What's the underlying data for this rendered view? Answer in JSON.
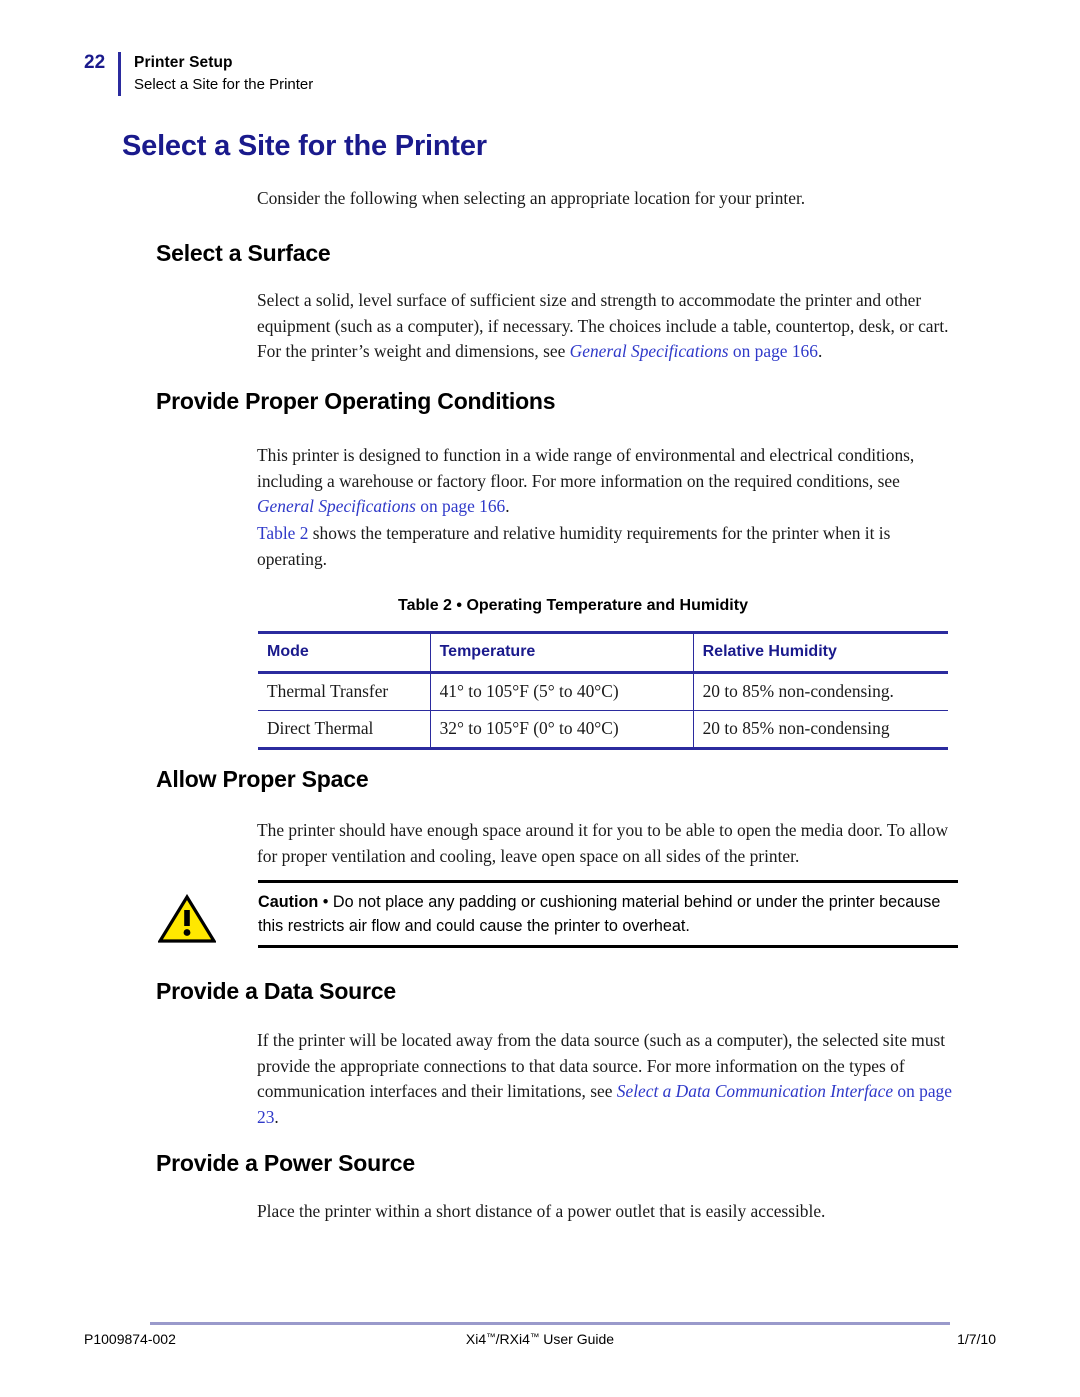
{
  "header": {
    "page_number": "22",
    "chapter": "Printer Setup",
    "section": "Select a Site for the Printer",
    "accent_color": "#2b2b9e"
  },
  "title": "Select a Site for the Printer",
  "title_color": "#1a1a8c",
  "intro_paragraph": "Consider the following when selecting an appropriate location for your printer.",
  "sections": [
    {
      "heading": "Select a Surface",
      "paragraph_lead": "Select a solid, level surface of sufficient size and strength to accommodate the printer and other equipment (such as a computer), if necessary. The choices include a table, countertop, desk, or cart. For the printer’s weight and dimensions, see ",
      "link_title": "General Specifications",
      "link_page": " on page 166",
      "paragraph_tail": "."
    },
    {
      "heading": "Provide Proper Operating Conditions",
      "paragraph_lead": "This printer is designed to function in a wide range of environmental and electrical conditions, including a warehouse or factory floor. For more information on the required conditions, see ",
      "link_title": "General Specifications",
      "link_page": " on page 166",
      "paragraph_tail": ".",
      "second_paragraph_link": "Table 2",
      "second_paragraph_rest": " shows the temperature and relative humidity requirements for the printer when it is operating."
    },
    {
      "heading": "Allow Proper Space",
      "paragraph": "The printer should have enough space around it for you to be able to open the media door. To allow for proper ventilation and cooling, leave open space on all sides of the printer."
    },
    {
      "heading": "Provide a Data Source",
      "paragraph_lead": "If the printer will be located away from the data source (such as a computer), the selected site must provide the appropriate connections to that data source. For more information on the types of communication interfaces and their limitations, see ",
      "link_title": "Select a Data Communication Interface",
      "link_page": " on page 23",
      "paragraph_tail": "."
    },
    {
      "heading": "Provide a Power Source",
      "paragraph": "Place the printer within a short distance of a power outlet that is easily accessible."
    }
  ],
  "table": {
    "caption": "Table 2 • Operating Temperature and Humidity",
    "header_color": "#1a1a8c",
    "border_color": "#2b2b9e",
    "columns": [
      "Mode",
      "Temperature",
      "Relative Humidity"
    ],
    "rows": [
      [
        "Thermal Transfer",
        "41° to 105°F (5° to 40°C)",
        "20 to 85% non-condensing."
      ],
      [
        "Direct Thermal",
        "32° to 105°F (0° to 40°C)",
        "20 to 85% non-condensing"
      ]
    ]
  },
  "caution": {
    "label": "Caution",
    "separator": " • ",
    "text": "Do not place any padding or cushioning material behind or under the printer because this restricts air flow and could cause the printer to overheat.",
    "icon": "warning-triangle-icon",
    "icon_fill": "#ffe800"
  },
  "footer": {
    "left": "P1009874-002",
    "center_pre": "Xi4",
    "center_mid": "/RXi4",
    "center_post": " User Guide",
    "tm": "™",
    "right": "1/7/10",
    "rule_color": "#9a9acb"
  }
}
